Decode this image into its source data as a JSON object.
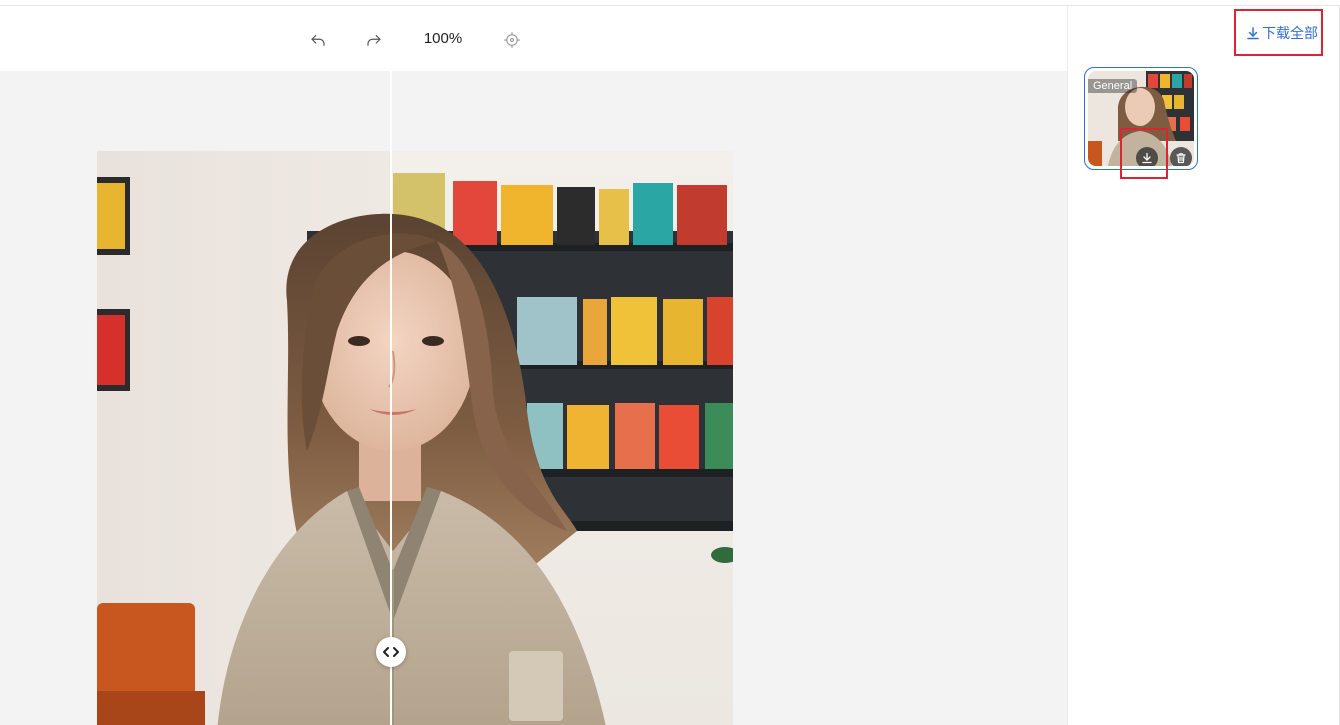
{
  "toolbar": {
    "undo_icon": "undo-icon",
    "redo_icon": "redo-icon",
    "zoom_level": "100%",
    "recenter_icon": "crosshair-icon"
  },
  "comparison": {
    "split_position_percent": 46,
    "handle_icon": "left-right-arrows-icon"
  },
  "side_panel": {
    "download_all_label": "下载全部",
    "download_all_icon": "download-icon",
    "results": [
      {
        "tag": "General",
        "download_icon": "download-icon",
        "delete_icon": "trash-icon",
        "selected": true
      }
    ]
  },
  "colors": {
    "accent": "#2f6fde",
    "highlight_box": "#e0242f",
    "canvas_bg": "#f3f3f3"
  }
}
